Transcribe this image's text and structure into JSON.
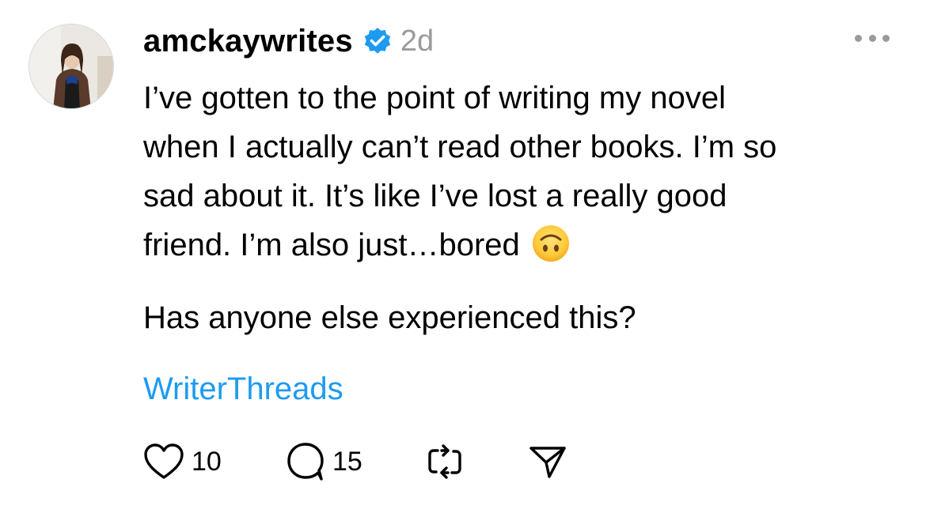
{
  "post": {
    "author": {
      "username": "amckaywrites",
      "verified_icon": "verified-badge-icon",
      "avatar_icon": "avatar-photo"
    },
    "time": "2d",
    "body_lines": [
      "I’ve gotten to the point of writing my novel",
      "when I actually can’t read other books. I’m so",
      "sad about it. It’s like I’ve lost a really good",
      "friend. I’m also just…bored"
    ],
    "emoji": "upside-down-face-emoji",
    "question": "Has anyone else experienced this?",
    "tag": "WriterThreads",
    "actions": {
      "like_count": "10",
      "reply_count": "15"
    }
  },
  "colors": {
    "accent_blue": "#1d9bf0",
    "muted_gray": "#9a9a9a",
    "text": "#000000"
  }
}
